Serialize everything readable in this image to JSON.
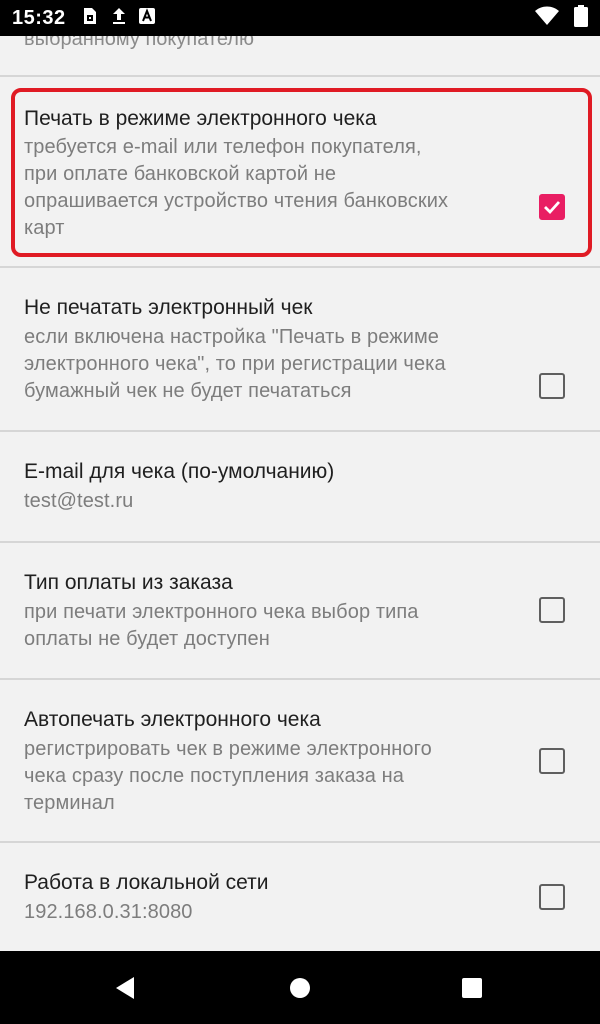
{
  "status_bar": {
    "time": "15:32",
    "icons": [
      "sim-card-icon",
      "upload-icon",
      "keyboard-a-icon",
      "wifi-icon",
      "battery-icon"
    ]
  },
  "partial_summary": "выбранному покупателю",
  "preferences": [
    {
      "title": "Печать в режиме электронного чека",
      "summary_lines": [
        "требуется e-mail или телефон покупателя,",
        "при оплате банковской картой не",
        "опрашивается устройство чтения банковских",
        "карт"
      ],
      "checked": true
    },
    {
      "title": "Не печатать электронный чек",
      "summary_lines": [
        "если включена настройка \"Печать в режиме",
        "электронного чека\", то при регистрации чека",
        "бумажный чек не будет печататься"
      ],
      "checked": false
    },
    {
      "title": "E-mail для чека (по-умолчанию)",
      "summary_lines": [
        "test@test.ru"
      ]
    },
    {
      "title": "Тип оплаты из заказа",
      "summary_lines": [
        "при печати электронного чека выбор типа",
        "оплаты не будет доступен"
      ],
      "checked": false
    },
    {
      "title": "Автопечать электронного чека",
      "summary_lines": [
        "регистрировать чек в режиме электронного",
        "чека сразу после поступления заказа на",
        "терминал"
      ],
      "checked": false
    },
    {
      "title": "Работа в локальной сети",
      "summary_lines": [
        "192.168.0.31:8080"
      ],
      "checked": false
    }
  ],
  "colors": {
    "accent": "#e91e63",
    "highlight": "#e01b24"
  }
}
